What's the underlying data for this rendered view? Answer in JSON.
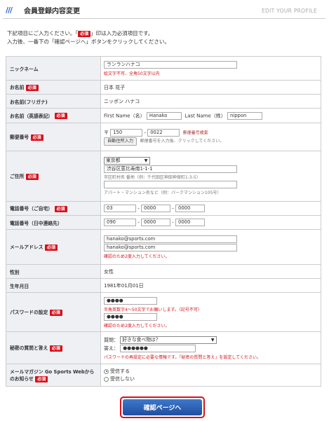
{
  "header": {
    "slashes": "///",
    "title": "会員登録内容変更",
    "subtitle": "EDIT YOUR PROFILE"
  },
  "intro": {
    "line1_a": "下記項目にご入力ください。「",
    "line1_b": "」印は入力必須項目です。",
    "line2": "入力後、一番下の「確認ページへ」ボタンをクリックしてください。"
  },
  "required_badge": "必須",
  "nickname": {
    "label": "ニックネーム",
    "value": "ランランハナコ",
    "error": "絵文字不可、全角50文字以内"
  },
  "name": {
    "label": "お名前",
    "value": "日本 花子"
  },
  "kana": {
    "label": "お名前(フリガナ)",
    "value": "ニッポン ハナコ"
  },
  "english_name": {
    "label": "お名前（英語表記）",
    "first_label": "First Name（名）",
    "first_value": "Hanako",
    "last_label": "Last Name（姓）",
    "last_value": "nippon"
  },
  "postal": {
    "label": "郵便番号",
    "prefix": "〒",
    "part1": "150",
    "dash": "-",
    "part2": "0022",
    "search_link": "郵便番号検索",
    "auto_button": "自動住所入力",
    "auto_note": "郵便番号を入力後、クリックしてください。"
  },
  "address": {
    "label": "ご住所",
    "prefecture": "東京都",
    "line1": "渋谷区恵比寿南1-1-1",
    "line1_hint": "市区町村名 番地（例：千代田区神田神保町1-3-5）",
    "line2": "",
    "line2_hint": "アパート・マンション名など（例：パークマンション105号）"
  },
  "phone_home": {
    "label": "電話番号（ご自宅）",
    "p1": "03",
    "p2": "0000",
    "p3": "0000",
    "dash": "-"
  },
  "phone_day": {
    "label": "電話番号（日中連絡先）",
    "p1": "090",
    "p2": "0000",
    "p3": "0000",
    "dash": "-"
  },
  "email": {
    "label": "メールアドレス",
    "value": "hanako@sports.com",
    "confirm": "hanako@sports.com",
    "note": "確認のため2度入力してください。"
  },
  "gender": {
    "label": "性別",
    "value": "女性"
  },
  "birthday": {
    "label": "生年月日",
    "value": "1981年01月01日"
  },
  "password": {
    "label": "パスワードの設定",
    "value": "●●●●",
    "hint": "半角英数字4～50文字でお願いします。（記号不可）",
    "confirm": "●●●●",
    "confirm_note": "確認のため2度入力してください。"
  },
  "secret": {
    "label": "秘密の質問と答え",
    "question_label": "質問：",
    "question": "好きな食べ物は？",
    "answer_label": "答え：",
    "answer": "●●●●●●",
    "note": "パスワードの再設定に必要な情報です。「秘密の質問と答え」を設定してください。"
  },
  "newsletter": {
    "label_line1": "メールマガジン Go Sports Webから",
    "label_line2": "のお知らせ",
    "opt_yes": "受信する",
    "opt_no": "受信しない",
    "selected": "受信する"
  },
  "submit": {
    "label": "確認ページへ"
  },
  "colors": {
    "accent": "#1f63c8",
    "required": "#d8111b",
    "label_bg": "#eef0f4"
  }
}
